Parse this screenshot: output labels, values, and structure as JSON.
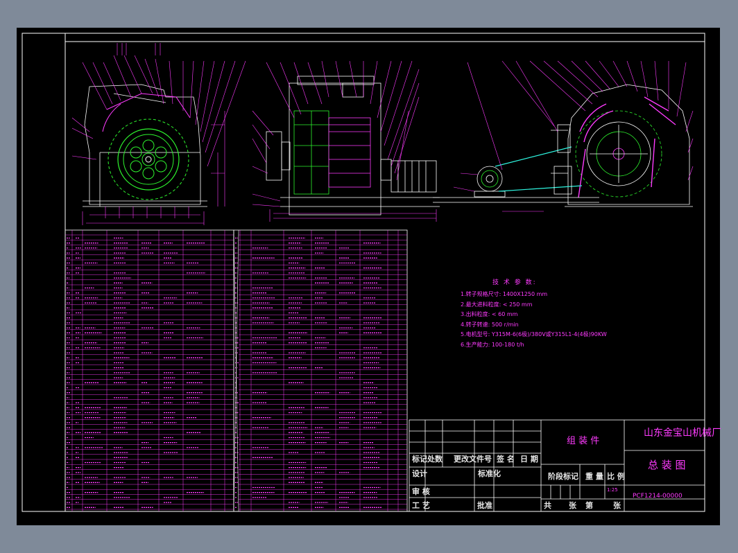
{
  "tech_params": {
    "title": "技 术 参 数:",
    "lines": [
      "1.转子规格尺寸: 1400X1250 mm",
      "2.最大进料粒度: < 250 mm",
      "3.出料粒度: < 60 mm",
      "4.转子转速: 500 r/min",
      "5.电机型号: Y315M-6(6极)/380V或Y315L1-4(4极)90KW",
      "6.生产能力: 100-180 t/h"
    ]
  },
  "title_block": {
    "assembly": "组 装 件",
    "company": "山东金宝山机械厂",
    "drawing_title": "总 装 图",
    "drawing_no": "PCF1214-00000",
    "scale": "1:25",
    "labels": {
      "mark": "标记",
      "count": "处数",
      "change_doc": "更改文件号",
      "sign": "签 名",
      "date": "日 期",
      "design": "设计",
      "standardize": "标准化",
      "stage_mark": "阶段标记",
      "weight": "重 量",
      "ratio": "比 例",
      "review": "审 核",
      "process": "工 艺",
      "approve": "批准",
      "total": "共",
      "sheet_word": "张",
      "page": "第",
      "sheet_word2": "张"
    }
  }
}
